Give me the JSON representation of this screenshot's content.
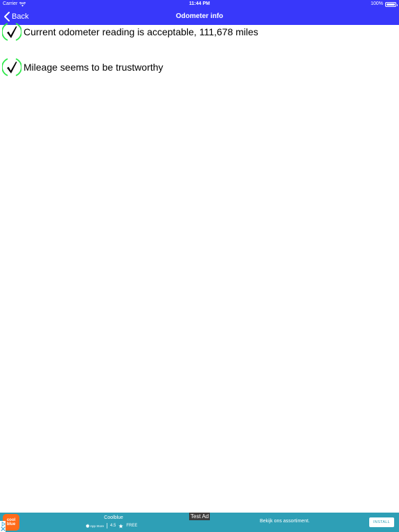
{
  "status_bar": {
    "carrier": "Carrier",
    "time": "11:44 PM",
    "battery": "100%"
  },
  "nav": {
    "back_label": "Back",
    "title": "Odometer info"
  },
  "results": [
    {
      "icon": "checkmark-icon",
      "text": "Current odometer reading is acceptable, 111,678 miles"
    },
    {
      "icon": "checkmark-icon",
      "text": "Mileage seems to be trustworthy"
    }
  ],
  "ad": {
    "logo_text_line1": "cool",
    "logo_text_line2": "blue",
    "app_name": "Coolblue",
    "store": "App Store",
    "rating": "4.5",
    "price": "FREE",
    "test_label": "Test Ad",
    "tagline": "Bekijk ons assortiment.",
    "install_label": "INSTALL"
  },
  "colors": {
    "nav_bg": "#3838fa",
    "check_ring": "#2ee84a",
    "ad_bg": "#2e9fb6",
    "ad_logo": "#ff6b1a"
  }
}
